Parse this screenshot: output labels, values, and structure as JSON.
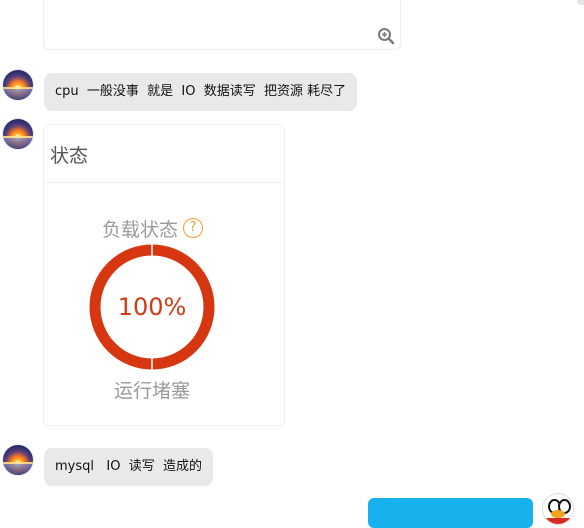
{
  "messages": [
    {
      "text": "cpu  一般没事  就是  IO  数据读写  把资源 耗尽了"
    },
    {
      "text": "mysql   IO  读写  造成的"
    }
  ],
  "status_card": {
    "title": "状态",
    "load_label": "负载状态",
    "help_icon": "?",
    "gauge_value": "100%",
    "gauge_fraction": 1.0,
    "gauge_color": "#d63710",
    "status_text": "运行堵塞"
  },
  "colors": {
    "bubble_bg": "#e9e9e9",
    "sent_bubble": "#19b0ee",
    "help_accent": "#f0a030"
  },
  "icons": {
    "zoom": "zoom-in-icon",
    "help": "help-circle-icon"
  }
}
